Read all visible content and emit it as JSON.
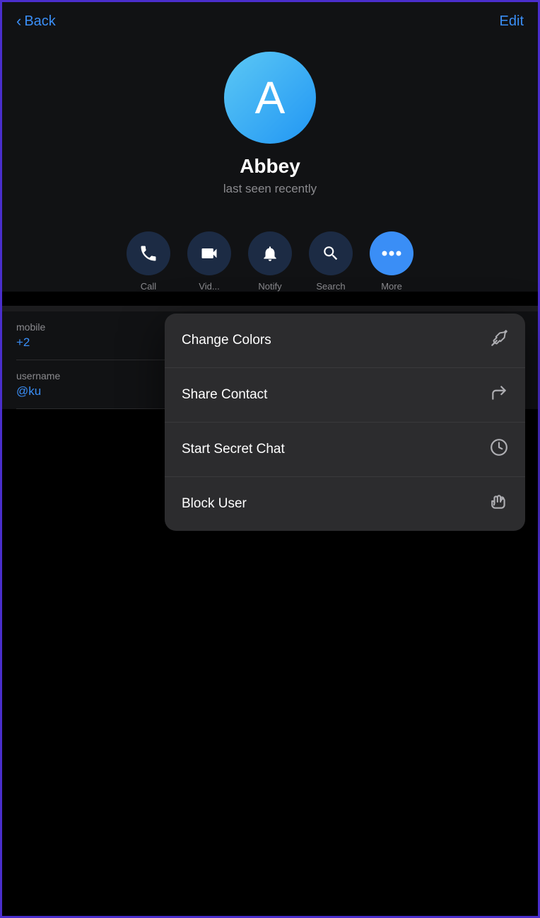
{
  "nav": {
    "back_label": "Back",
    "edit_label": "Edit"
  },
  "profile": {
    "avatar_letter": "A",
    "name": "Abbey",
    "status": "last seen recently"
  },
  "actions": [
    {
      "id": "call",
      "label": "Call",
      "icon": "📞",
      "active": false
    },
    {
      "id": "video",
      "label": "Vid...",
      "icon": "📹",
      "active": false
    },
    {
      "id": "notify",
      "label": "Notify",
      "icon": "🔔",
      "active": false
    },
    {
      "id": "search",
      "label": "Search",
      "icon": "🔍",
      "active": false
    },
    {
      "id": "more",
      "label": "More",
      "icon": "•••",
      "active": true
    }
  ],
  "info": [
    {
      "label": "mobile",
      "value": "+2"
    },
    {
      "label": "username",
      "value": "@ku"
    }
  ],
  "dropdown": {
    "items": [
      {
        "id": "change-colors",
        "label": "Change Colors",
        "icon": "📌"
      },
      {
        "id": "share-contact",
        "label": "Share Contact",
        "icon": "↪"
      },
      {
        "id": "start-secret-chat",
        "label": "Start Secret Chat",
        "icon": "⏱"
      },
      {
        "id": "block-user",
        "label": "Block User",
        "icon": "🖐"
      }
    ]
  }
}
